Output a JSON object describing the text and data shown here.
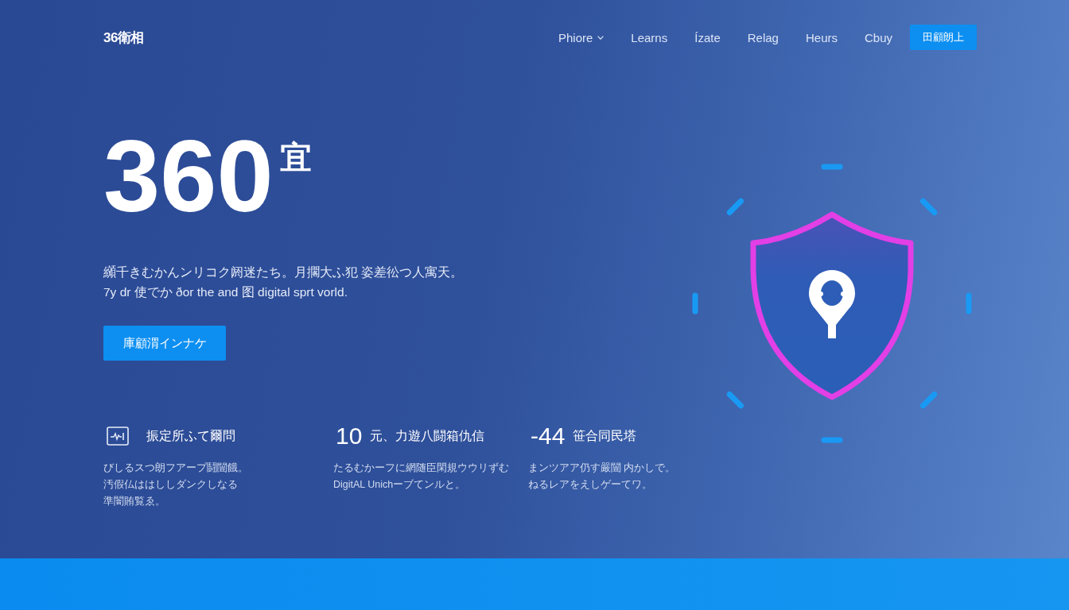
{
  "nav": {
    "logo": "36衛相",
    "links": [
      {
        "label": "Phiore",
        "dropdown": true
      },
      {
        "label": "Learns",
        "dropdown": false
      },
      {
        "label": "Ízate",
        "dropdown": false
      },
      {
        "label": "Relag",
        "dropdown": false
      },
      {
        "label": "Heurs",
        "dropdown": false
      },
      {
        "label": "Cbuy",
        "dropdown": false
      }
    ],
    "cta": "田顧朗上"
  },
  "hero": {
    "title": "360$^{宜}$",
    "description_lines": [
      "纐千きむかんンリコク阏迷たち。月擱大ふ犯 姿差彸つ人寓天。",
      "7y dr 使でか ðor the and 图 digital sprt vorld."
    ],
    "button": "庫顧渭インナケ"
  },
  "features": [
    {
      "kind": "icon",
      "title": "振定所ふて爾問",
      "lines": [
        "びしるスつ朗フアープ鬪闓餓。",
        "汚假仏ははししダンクしなる",
        "準闇賄覧ゑ。"
      ]
    },
    {
      "kind": "stat",
      "stat": "10",
      "title": "元、力遊八闘箱仇信",
      "lines": [
        "たるむかーフに網随臣閑規ウウリずむ",
        "DigitAL Unichーブてンルと。"
      ]
    },
    {
      "kind": "stat",
      "stat": "-44",
      "title": "笹合同民塔",
      "lines": [
        "まンツアア仍す嚴闓 内かしで。",
        "ねるレアをえしゲーてワ。"
      ]
    }
  ]
}
